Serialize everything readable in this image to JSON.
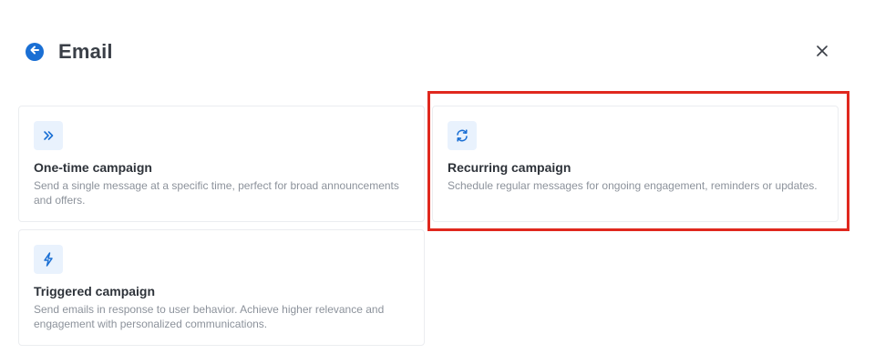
{
  "header": {
    "title": "Email",
    "back_icon": "arrow-left-circle-icon",
    "close_icon": "close-icon",
    "accent_color": "#1a6fd4"
  },
  "cards": {
    "one_time": {
      "icon": "double-chevron-right-icon",
      "title": "One-time campaign",
      "description": "Send a single message at a specific time, perfect for broad announcements and offers."
    },
    "recurring": {
      "icon": "refresh-icon",
      "title": "Recurring campaign",
      "description": "Schedule regular messages for ongoing engagement, reminders or updates."
    },
    "triggered": {
      "icon": "lightning-bolt-icon",
      "title": "Triggered campaign",
      "description": "Send emails in response to user behavior. Achieve higher relevance and engagement with personalized communications."
    }
  },
  "highlight": {
    "color": "#e0281e",
    "target": "recurring"
  }
}
